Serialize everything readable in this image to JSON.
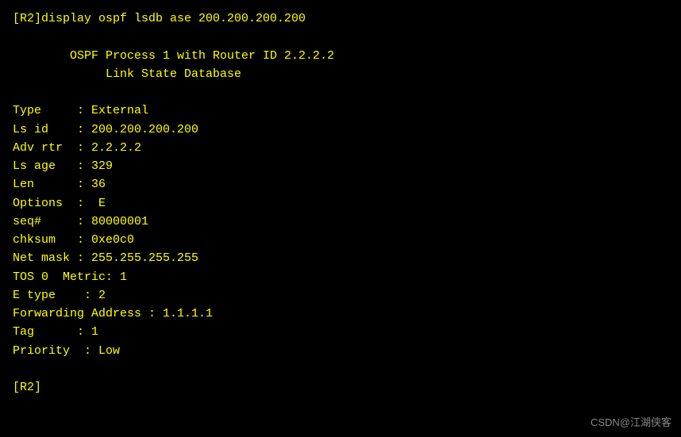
{
  "terminal": {
    "command_line": "[R2]display ospf lsdb ase 200.200.200.200",
    "blank1": "",
    "header1": "        OSPF Process 1 with Router ID 2.2.2.2",
    "header2": "             Link State Database",
    "blank2": "",
    "fields": [
      {
        "label": "Type",
        "separator": "     : ",
        "value": "External"
      },
      {
        "label": "Ls id",
        "separator": "    : ",
        "value": "200.200.200.200"
      },
      {
        "label": "Adv rtr",
        "separator": "  : ",
        "value": "2.2.2.2"
      },
      {
        "label": "Ls age",
        "separator": "   : ",
        "value": "329"
      },
      {
        "label": "Len",
        "separator": "      : ",
        "value": "36"
      },
      {
        "label": "Options",
        "separator": "  :  ",
        "value": "E"
      },
      {
        "label": "seq#",
        "separator": "     : ",
        "value": "80000001"
      },
      {
        "label": "chksum",
        "separator": "   : ",
        "value": "0xe0c0"
      },
      {
        "label": "Net mask",
        "separator": " : ",
        "value": "255.255.255.255"
      },
      {
        "label": "TOS 0",
        "separator": "  Metric: ",
        "value": "1"
      },
      {
        "label": "E type",
        "separator": "    : ",
        "value": "2"
      },
      {
        "label": "Forwarding Address",
        "separator": " : ",
        "value": "1.1.1.1"
      },
      {
        "label": "Tag",
        "separator": "      : ",
        "value": "1"
      },
      {
        "label": "Priority",
        "separator": "  : ",
        "value": "Low"
      }
    ],
    "blank3": "",
    "prompt_end": "[R2]",
    "watermark": "CSDN@江湖侠客"
  }
}
